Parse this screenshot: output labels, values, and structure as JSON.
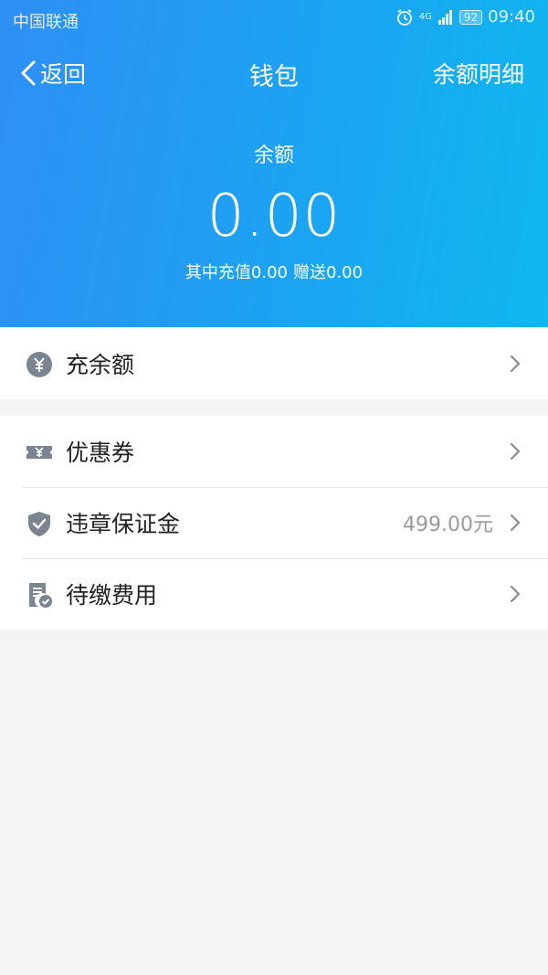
{
  "statusbar": {
    "carrier": "中国联通",
    "network": "4G",
    "battery": "92",
    "time": "09:40"
  },
  "nav": {
    "back_label": "返回",
    "title": "钱包",
    "detail_label": "余额明细"
  },
  "balance": {
    "label": "余额",
    "value": "0.00",
    "recharge_text": "其中充值0.00",
    "gift_text": "赠送0.00"
  },
  "menu": {
    "recharge": {
      "label": "充余额",
      "icon": "yuan-coin-icon"
    },
    "coupon": {
      "label": "优惠券",
      "icon": "ticket-icon"
    },
    "deposit": {
      "label": "违章保证金",
      "value": "499.00元",
      "icon": "shield-check-icon"
    },
    "pending": {
      "label": "待缴费用",
      "icon": "bill-icon"
    }
  },
  "colors": {
    "header_start": "#2f8ff5",
    "header_end": "#0fb8ef",
    "icon_gray": "#7b8591",
    "background": "#f4f4f4"
  }
}
